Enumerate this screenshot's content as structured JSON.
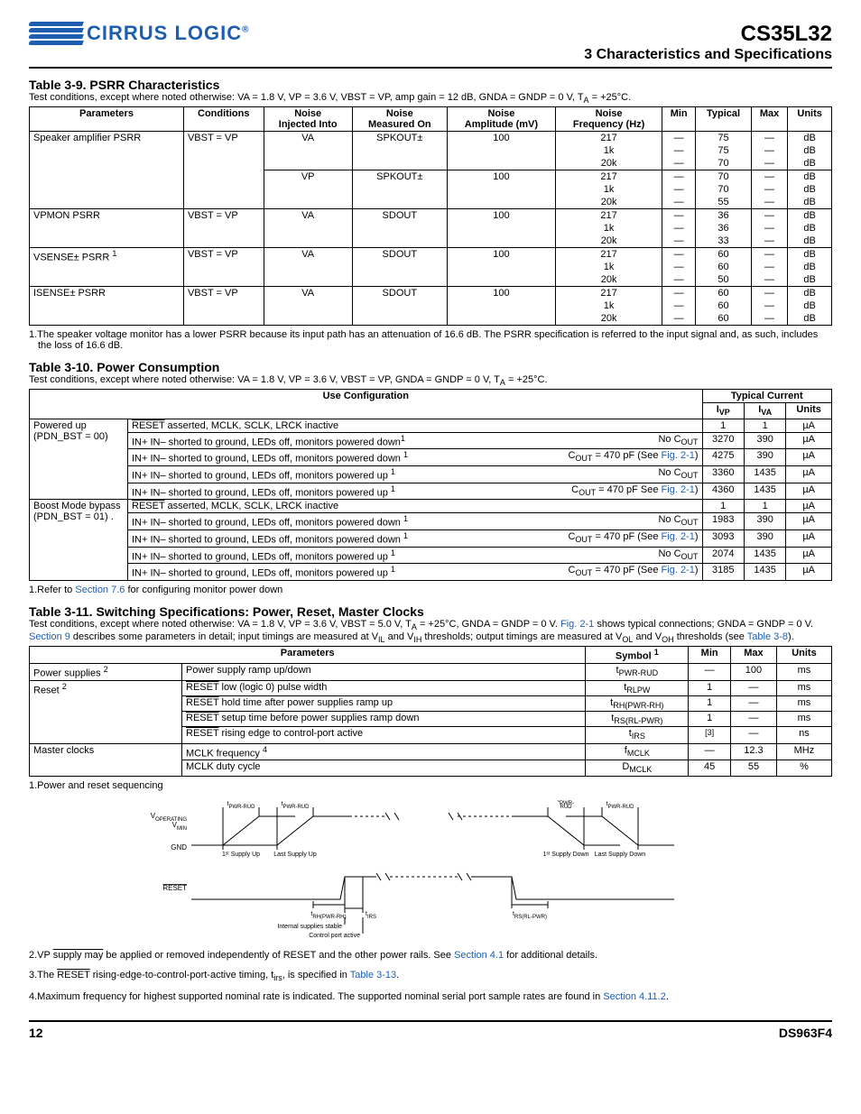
{
  "header": {
    "logo_text": "CIRRUS LOGIC",
    "doc_title": "CS35L32",
    "doc_subtitle": "3 Characteristics and Specifications"
  },
  "t39": {
    "title": "Table 3-9. PSRR Characteristics",
    "cond": "Test conditions, except where noted otherwise: VA = 1.8 V, VP = 3.6 V, VBST = VP, amp gain = 12 dB, GNDA = GNDP = 0 V, T",
    "cond_sub": "A",
    "cond_tail": " = +25°C.",
    "hdr": [
      "Parameters",
      "Conditions",
      "Noise Injected Into",
      "Noise Measured On",
      "Noise Amplitude (mV)",
      "Noise Frequency (Hz)",
      "Min",
      "Typical",
      "Max",
      "Units"
    ],
    "rows": [
      {
        "param": "Speaker amplifier PSRR",
        "cond": "VBST = VP",
        "inj": "VA",
        "meas": "SPKOUT±",
        "amp": "100",
        "freqs": [
          "217",
          "1k",
          "20k"
        ],
        "min": [
          "—",
          "—",
          "—"
        ],
        "typ": [
          "75",
          "75",
          "70"
        ],
        "max": [
          "—",
          "—",
          "—"
        ],
        "units": [
          "dB",
          "dB",
          "dB"
        ]
      },
      {
        "param": "",
        "cond": "",
        "inj": "VP",
        "meas": "SPKOUT±",
        "amp": "100",
        "freqs": [
          "217",
          "1k",
          "20k"
        ],
        "min": [
          "—",
          "—",
          "—"
        ],
        "typ": [
          "70",
          "70",
          "55"
        ],
        "max": [
          "—",
          "—",
          "—"
        ],
        "units": [
          "dB",
          "dB",
          "dB"
        ]
      },
      {
        "param": "VPMON PSRR",
        "cond": "VBST = VP",
        "inj": "VA",
        "meas": "SDOUT",
        "amp": "100",
        "freqs": [
          "217",
          "1k",
          "20k"
        ],
        "min": [
          "—",
          "—",
          "—"
        ],
        "typ": [
          "36",
          "36",
          "33"
        ],
        "max": [
          "—",
          "—",
          "—"
        ],
        "units": [
          "dB",
          "dB",
          "dB"
        ]
      },
      {
        "param": "VSENSE± PSRR ",
        "sup": "1",
        "cond": "VBST = VP",
        "inj": "VA",
        "meas": "SDOUT",
        "amp": "100",
        "freqs": [
          "217",
          "1k",
          "20k"
        ],
        "min": [
          "—",
          "—",
          "—"
        ],
        "typ": [
          "60",
          "60",
          "50"
        ],
        "max": [
          "—",
          "—",
          "—"
        ],
        "units": [
          "dB",
          "dB",
          "dB"
        ]
      },
      {
        "param": "ISENSE± PSRR",
        "cond": "VBST = VP",
        "inj": "VA",
        "meas": "SDOUT",
        "amp": "100",
        "freqs": [
          "217",
          "1k",
          "20k"
        ],
        "min": [
          "—",
          "—",
          "—"
        ],
        "typ": [
          "60",
          "60",
          "60"
        ],
        "max": [
          "—",
          "—",
          "—"
        ],
        "units": [
          "dB",
          "dB",
          "dB"
        ]
      }
    ],
    "note1": "1.The speaker voltage monitor has a lower PSRR because its input path has an attenuation of 16.6 dB. The PSRR specification is referred to the input signal and, as such, includes the loss of 16.6 dB."
  },
  "t310": {
    "title": "Table 3-10. Power Consumption",
    "cond": "Test conditions, except where noted otherwise: VA = 1.8 V, VP = 3.6 V, VBST = VP, GNDA = GNDP = 0 V, T",
    "cond_sub": "A",
    "cond_tail": " = +25°C.",
    "hdr_use": "Use Configuration",
    "hdr_typ": "Typical Current",
    "hdr_ivp": "I",
    "hdr_ivp_sub": "VP",
    "hdr_iva": "I",
    "hdr_iva_sub": "VA",
    "hdr_units": "Units",
    "groups": [
      {
        "label": "Powered up (PDN_BST = 00)",
        "rows": [
          {
            "desc": "RESET asserted, MCLK, SCLK, LRCK inactive",
            "cap": "",
            "ivp": "1",
            "iva": "1",
            "u": "µA",
            "over": true
          },
          {
            "desc": "IN+ IN– shorted to ground, LEDs off, monitors powered down",
            "sup": "1",
            "cap": "No C",
            "capsub": "OUT",
            "ivp": "3270",
            "iva": "390",
            "u": "µA"
          },
          {
            "desc": "IN+ IN– shorted to ground, LEDs off, monitors powered down ",
            "sup": "1",
            "cap": "C",
            "capsub": "OUT",
            "captail": " = 470 pF (See ",
            "caplink": "Fig. 2-1",
            "capend": ")",
            "ivp": "4275",
            "iva": "390",
            "u": "µA"
          },
          {
            "desc": "IN+ IN– shorted to ground, LEDs off, monitors powered up ",
            "sup": "1",
            "cap": "No C",
            "capsub": "OUT",
            "ivp": "3360",
            "iva": "1435",
            "u": "µA"
          },
          {
            "desc": "IN+ IN– shorted to ground, LEDs off, monitors powered up ",
            "sup": "1",
            "cap": "C",
            "capsub": "OUT",
            "captail": " = 470 pF See ",
            "caplink": "Fig. 2-1",
            "capend": ")",
            "ivp": "4360",
            "iva": "1435",
            "u": "µA"
          }
        ]
      },
      {
        "label": "Boost Mode bypass (PDN_BST = 01) .",
        "rows": [
          {
            "desc": "RESET asserted, MCLK, SCLK, LRCK inactive",
            "cap": "",
            "ivp": "1",
            "iva": "1",
            "u": "µA",
            "over": true
          },
          {
            "desc": "IN+ IN– shorted to ground, LEDs off, monitors powered down ",
            "sup": "1",
            "cap": "No C",
            "capsub": "OUT",
            "ivp": "1983",
            "iva": "390",
            "u": "µA"
          },
          {
            "desc": "IN+ IN– shorted to ground, LEDs off, monitors powered down ",
            "sup": "1",
            "cap": "C",
            "capsub": "OUT",
            "captail": " = 470 pF (See ",
            "caplink": "Fig. 2-1",
            "capend": ")",
            "ivp": "3093",
            "iva": "390",
            "u": "µA"
          },
          {
            "desc": "IN+ IN– shorted to ground, LEDs off, monitors powered up ",
            "sup": "1",
            "cap": "No C",
            "capsub": "OUT",
            "ivp": "2074",
            "iva": "1435",
            "u": "µA"
          },
          {
            "desc": "IN+ IN– shorted to ground, LEDs off, monitors powered up ",
            "sup": "1",
            "cap": "C",
            "capsub": "OUT",
            "captail": " = 470 pF (See ",
            "caplink": "Fig. 2-1",
            "capend": ")",
            "ivp": "3185",
            "iva": "1435",
            "u": "µA"
          }
        ]
      }
    ],
    "note1_pre": "1.Refer to ",
    "note1_link": "Section 7.6",
    "note1_post": " for configuring monitor power down"
  },
  "t311": {
    "title": "Table 3-11. Switching Specifications: Power, Reset, Master Clocks",
    "cond_a": "Test conditions, except where noted otherwise: VA = 1.8 V, VP = 3.6 V, VBST = 5.0 V, T",
    "cond_a_sub": "A",
    "cond_a_tail": " = +25°C, GNDA = GNDP = 0 V. ",
    "cond_link1": "Fig. 2-1",
    "cond_b": " shows typical connections; GNDA = GNDP = 0 V. ",
    "cond_link2": "Section 9",
    "cond_c": " describes some parameters in detail; input timings are measured at V",
    "cond_c_sub1": "IL",
    "cond_c_mid": " and V",
    "cond_c_sub2": "IH",
    "cond_c_tail": " thresholds; output timings are measured at V",
    "cond_c_sub3": "OL",
    "cond_c_mid2": " and V",
    "cond_c_sub4": "OH",
    "cond_c_tail2": " thresholds (see ",
    "cond_link3": "Table 3-8",
    "cond_end": ").",
    "hdr": [
      "Parameters",
      "",
      "Symbol ",
      "Min",
      "Max",
      "Units"
    ],
    "hdr_sup": "1",
    "rows": [
      {
        "group": "Power supplies ",
        "gsup": "2",
        "p": "Power supply ramp up/down",
        "s": "t",
        "ssub": "PWR-RUD",
        "min": "—",
        "max": "100",
        "u": "ms"
      },
      {
        "group": "Reset ",
        "gsup": "2",
        "rowspan": 4,
        "p": "RESET low (logic 0) pulse width",
        "over": true,
        "s": "t",
        "ssub": "RLPW",
        "min": "1",
        "max": "—",
        "u": "ms"
      },
      {
        "p": "RESET hold time after power supplies ramp up",
        "over": true,
        "s": "t",
        "ssub": "RH(PWR-RH)",
        "min": "1",
        "max": "—",
        "u": "ms"
      },
      {
        "p": "RESET setup time before power supplies ramp down",
        "over": true,
        "s": "t",
        "ssub": "RS(RL-PWR)",
        "min": "1",
        "max": "—",
        "u": "ms"
      },
      {
        "p": "RESET rising edge to control-port active",
        "over": true,
        "s": "t",
        "ssub": "IRS",
        "min": "[3]",
        "max": "—",
        "u": "ns",
        "min_sup": true
      },
      {
        "group": "Master clocks",
        "rowspan": 2,
        "p": "MCLK frequency ",
        "psup": "4",
        "s": "f",
        "ssub": "MCLK",
        "min": "—",
        "max": "12.3",
        "u": "MHz"
      },
      {
        "p": "MCLK duty cycle",
        "s": "D",
        "ssub": "MCLK",
        "min": "45",
        "max": "55",
        "u": "%"
      }
    ],
    "note1": "1.Power and reset sequencing",
    "note2_pre": "2.VP supply may be applied or removed independently of RESET and the other power rails. See ",
    "note2_link": "Section 4.1",
    "note2_post": " for additional details.",
    "note2_over": "supply may",
    "note3_pre": "3.The ",
    "note3_over": "RESET",
    "note3_mid": " rising-edge-to-control-port-active timing, t",
    "note3_sub": "irs",
    "note3_mid2": ", is specified in ",
    "note3_link": "Table 3-13",
    "note3_post": ".",
    "note4_pre": "4.Maximum frequency for highest supported nominal rate is indicated. The supported nominal serial port sample rates are found in ",
    "note4_link": "Section 4.11.2",
    "note4_post": "."
  },
  "diagram": {
    "labels": {
      "voperating": "V",
      "voperating_sub": "OPERATING",
      "vmin": "V",
      "vmin_sub": "MIN",
      "gnd": "GND",
      "reset": "RESET",
      "tpwrrud": "t",
      "tpwrrud_sub": "PWR-RUD",
      "tpwr": "t",
      "tpwr_sub": "PWR-",
      "tpwr_sub2": "RUD",
      "first_up": "1ˢᵗ Supply Up",
      "last_up": "Last Supply Up",
      "first_down": "1ˢᵗ Supply Down",
      "last_down": "Last Supply Down",
      "trh": "t",
      "trh_sub": "RH(PWR-RH)",
      "tirs": "t",
      "tirs_sub": "IRS",
      "trs": "t",
      "trs_sub": "RS(RL-PWR)",
      "internal": "Internal supplies stable",
      "control": "Control port active"
    }
  },
  "footer": {
    "page": "12",
    "doc": "DS963F4"
  }
}
